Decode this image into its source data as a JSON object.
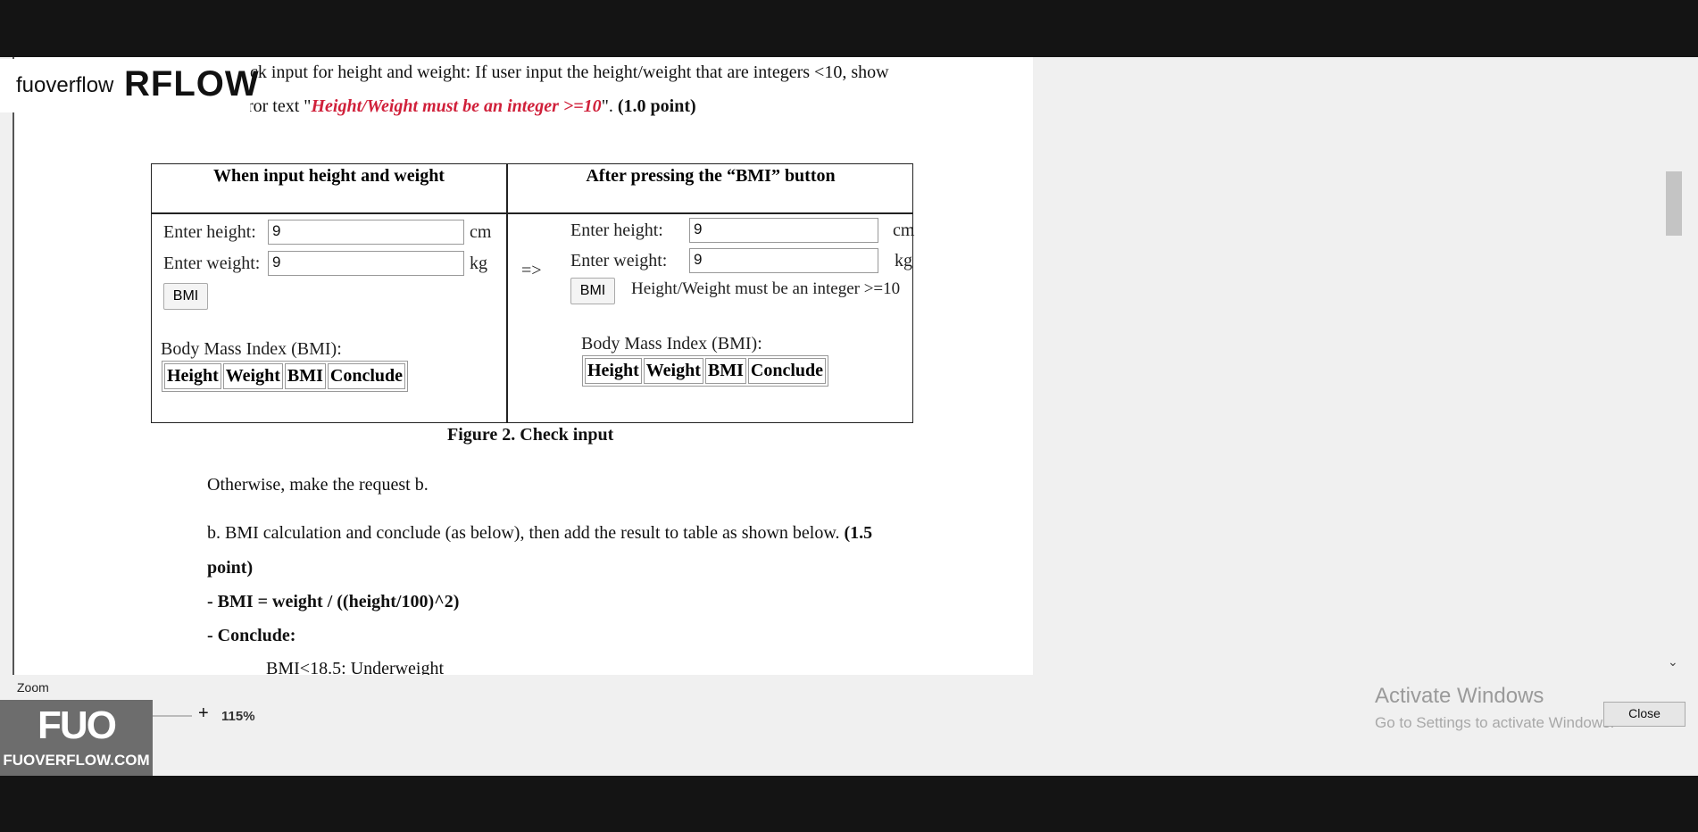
{
  "watermark": {
    "small": "fuoverflow",
    "big": "RFLOW",
    "badge_mark": "FUO",
    "badge_url": "FUOVERFLOW.COM"
  },
  "doc": {
    "line1": "ck input for height and weight: If user input the height/weight that are integers <10, show",
    "line2_prefix": "the error text \"",
    "line2_error": "Height/Weight must be an integer >=10",
    "line2_suffix": "\". ",
    "line2_points": "(1.0 point)",
    "figure": {
      "col1_header": "When input height and weight",
      "col2_header": "After pressing the “BMI” button",
      "arrow": "=>",
      "left": {
        "height_label": "Enter height:",
        "height_value": "9",
        "height_unit": "cm",
        "weight_label": "Enter weight:",
        "weight_value": "9",
        "weight_unit": "kg",
        "bmi_button": "BMI",
        "result_label": "Body Mass Index (BMI):",
        "table_headers": [
          "Height",
          "Weight",
          "BMI",
          "Conclude"
        ]
      },
      "right": {
        "height_label": "Enter height:",
        "height_value": "9",
        "height_unit": "cm",
        "weight_label": "Enter weight:",
        "weight_value": "9",
        "weight_unit": "kg",
        "bmi_button": "BMI",
        "error_text": "Height/Weight must be an integer >=10",
        "result_label": "Body Mass Index (BMI):",
        "table_headers": [
          "Height",
          "Weight",
          "BMI",
          "Conclude"
        ]
      },
      "caption": "Figure 2. Check input"
    },
    "otherwise": "Otherwise, make the request b.",
    "b_line1": "b. BMI calculation and conclude (as below), then add the result to table as shown below. ",
    "b_points_1": "(1.5",
    "b_points_2": "point)",
    "formula": "- BMI = weight / ((height/100)^2)",
    "conclude": "- Conclude:",
    "underweight": "BMI<18.5: Underweight"
  },
  "zoom": {
    "label": "Zoom",
    "minus": "-",
    "plus": "+",
    "value": "115%"
  },
  "activation": {
    "title": "Activate Windows",
    "subtitle": "Go to Settings to activate Windows."
  },
  "close_button": "Close"
}
